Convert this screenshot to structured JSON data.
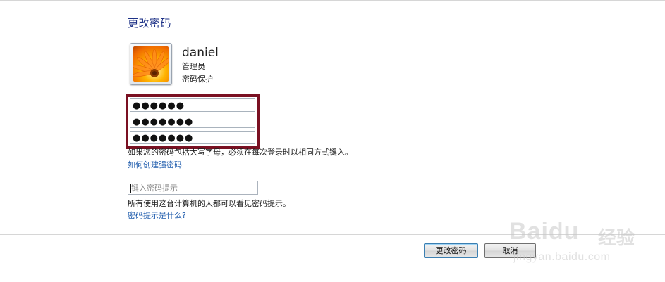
{
  "header": {
    "title": "更改密码"
  },
  "user": {
    "name": "daniel",
    "role": "管理员",
    "protection": "密码保护",
    "avatar_icon": "flower-avatar-icon"
  },
  "password_fields": {
    "current_masked": "●●●●●●",
    "new_masked": "●●●●●●●",
    "confirm_masked": "●●●●●●●",
    "highlight_color": "#7a1022"
  },
  "hints": {
    "case_note": "如果您的密码包括大写字母，必须在每次登录时以相同方式键入。",
    "strong_link": "如何创建强密码",
    "hint_placeholder": "键入密码提示",
    "hint_value": "",
    "visible_note": "所有使用这台计算机的人都可以看见密码提示。",
    "hint_link": "密码提示是什么?"
  },
  "buttons": {
    "change_label": "更改密码",
    "cancel_label": "取消"
  },
  "watermark": {
    "logo": "Baidu",
    "jy": "经验",
    "url": "jingyan.baidu.com"
  },
  "colors": {
    "title": "#1e3287",
    "link": "#1f5cad"
  }
}
